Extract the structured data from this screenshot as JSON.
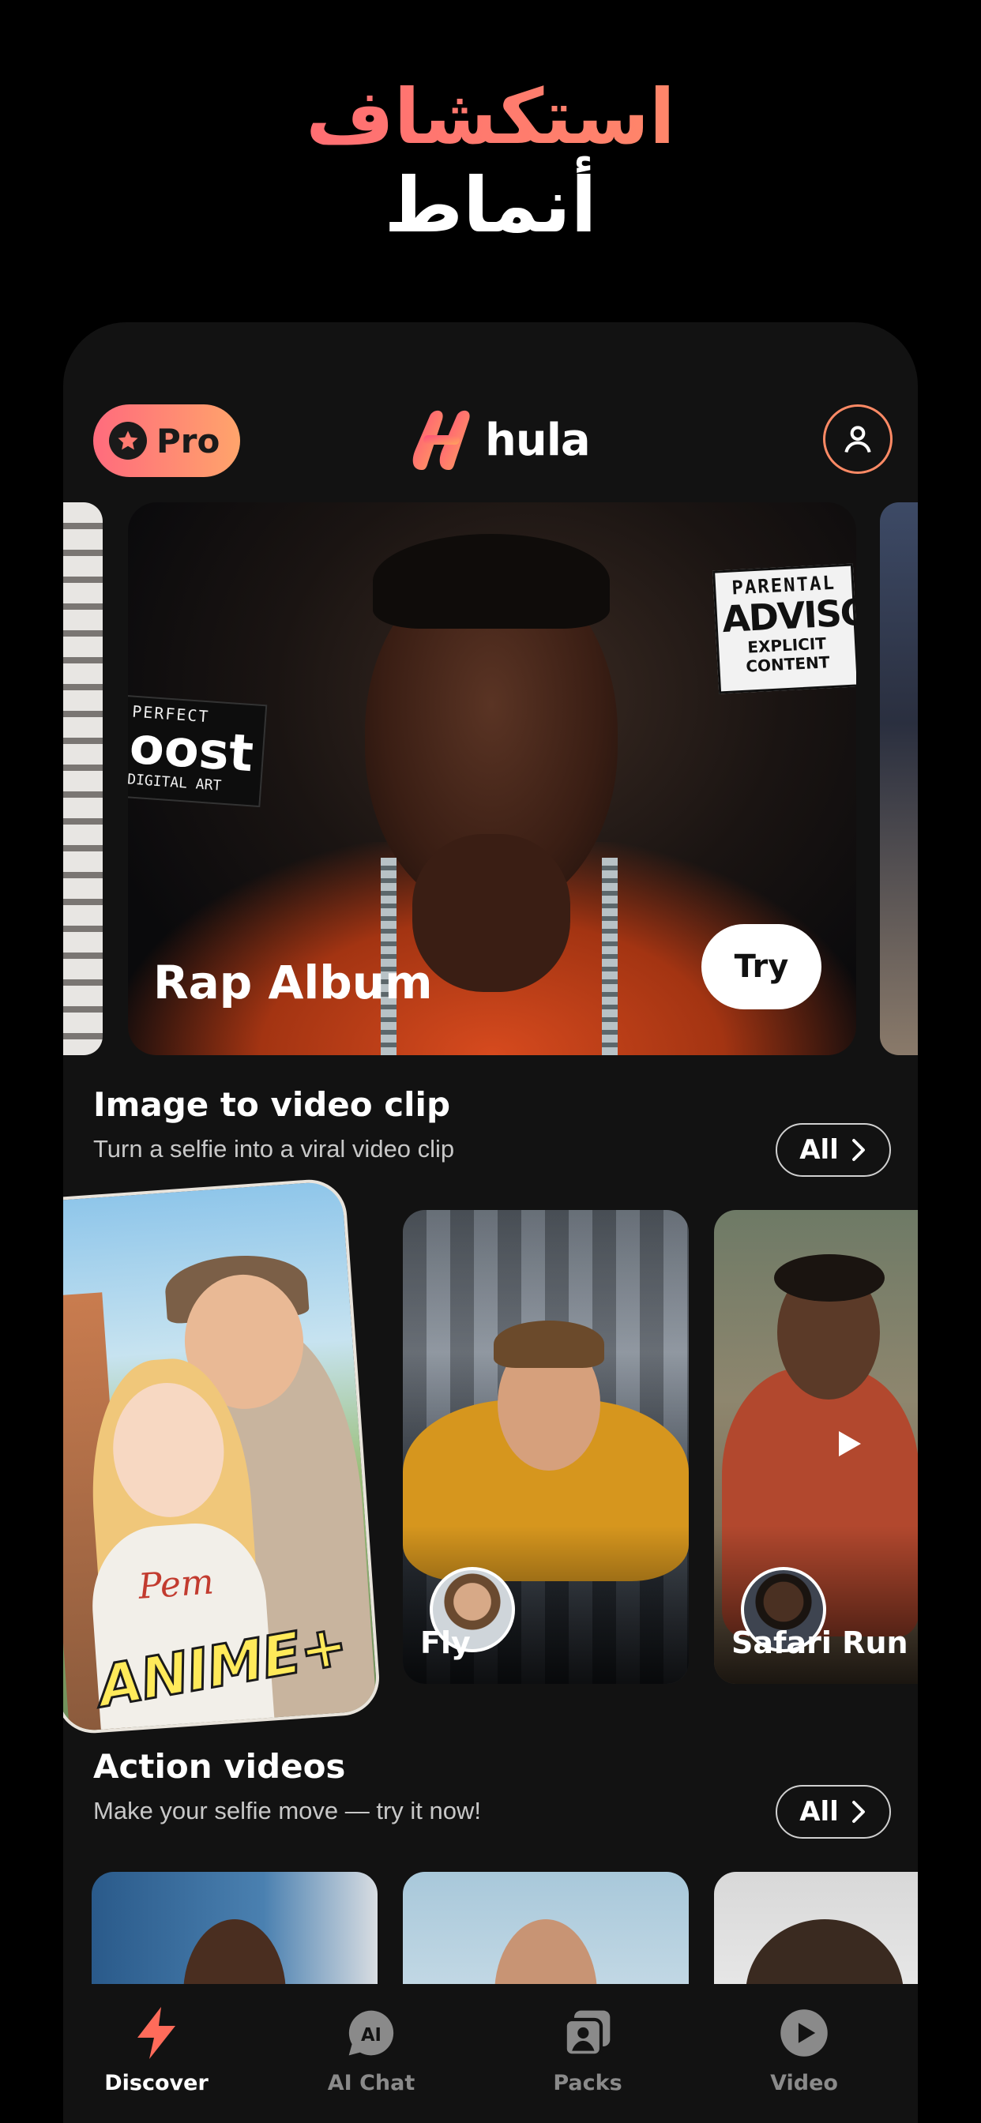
{
  "promo": {
    "line1": "استكشاف",
    "line2": "أنماط"
  },
  "header": {
    "pro_label": "Pro",
    "logo_text": "hula"
  },
  "hero": {
    "title": "Rap Album",
    "try_label": "Try",
    "sticker_advisory": [
      "PARENTAL",
      "ADVISORY",
      "EXPLICIT CONTENT"
    ],
    "sticker_post": [
      "PERFECT",
      "oost",
      "DIGITAL ART"
    ]
  },
  "image_to_video": {
    "title": "Image to video clip",
    "subtitle": "Turn a selfie into a viral video clip",
    "all_label": "All",
    "cards": [
      {
        "title": "ANIME+",
        "shirt_text": "Pem"
      },
      {
        "title": "Fly"
      },
      {
        "title": "Safari Run"
      }
    ]
  },
  "action_videos": {
    "title": "Action videos",
    "subtitle": "Make your selfie move — try it now!",
    "all_label": "All"
  },
  "tabbar": {
    "active": "Discover",
    "accent": "#ff6b5a",
    "items": [
      {
        "label": "Discover",
        "icon": "lightning-icon"
      },
      {
        "label": "AI Chat",
        "icon": "ai-chat-icon",
        "badge": "AI"
      },
      {
        "label": "Packs",
        "icon": "packs-icon"
      },
      {
        "label": "Video",
        "icon": "play-circle-icon"
      }
    ]
  },
  "colors": {
    "accent_gradient_start": "#ff5a7a",
    "accent_gradient_end": "#ffa46b",
    "background": "#121212"
  }
}
